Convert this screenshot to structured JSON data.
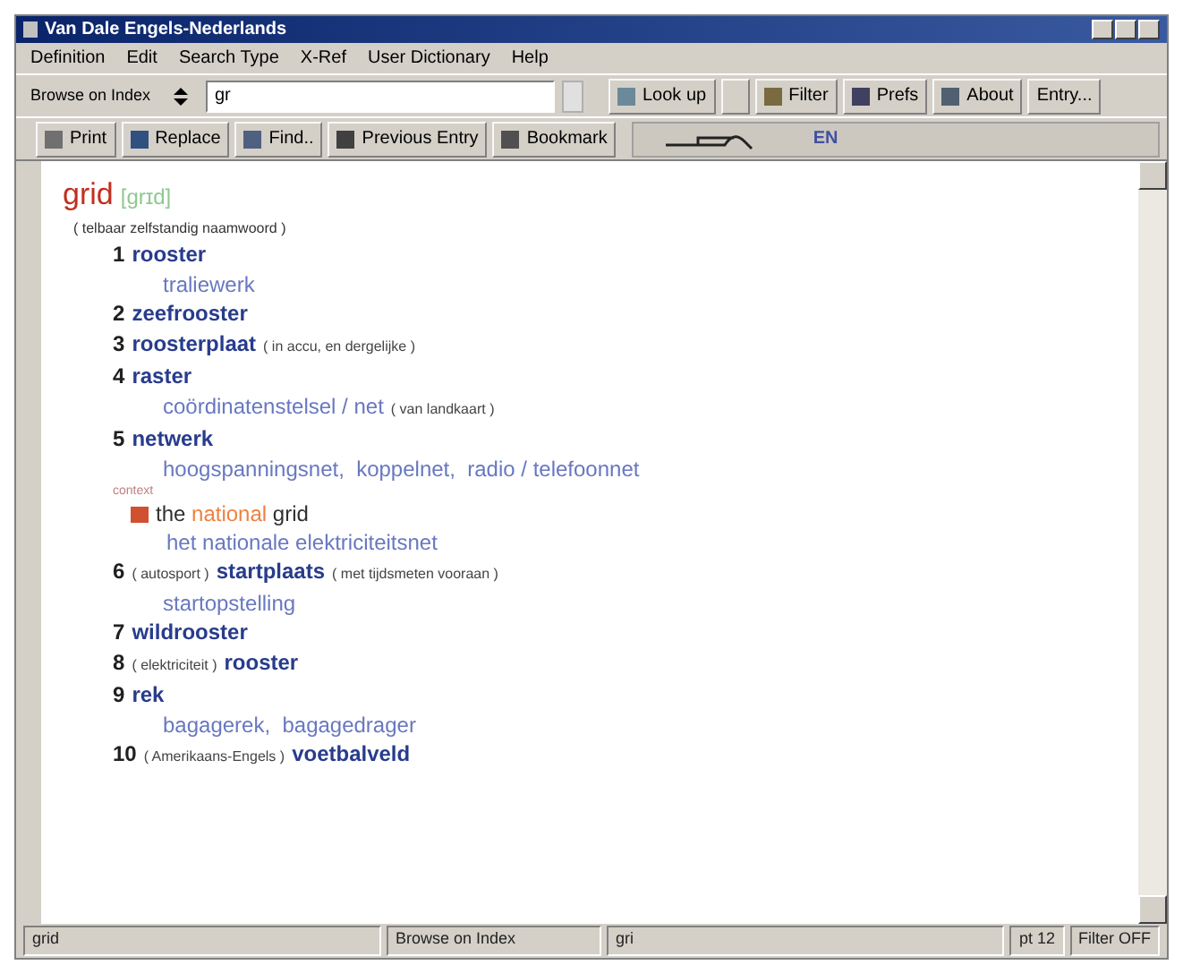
{
  "window": {
    "title": "Van Dale Engels-Nederlands"
  },
  "menu": [
    "Definition",
    "Edit",
    "Search Type",
    "X-Ref",
    "User Dictionary",
    "Help"
  ],
  "toolbar": {
    "mode": "Browse on Index",
    "search": {
      "value": "gr"
    },
    "buttons": [
      {
        "label": "Look up",
        "kind": "lookup"
      },
      {
        "kind": "blank"
      },
      {
        "label": "Filter",
        "kind": "filter"
      },
      {
        "label": "Prefs",
        "kind": "prefs"
      },
      {
        "label": "About",
        "kind": "about"
      },
      {
        "label": "Entry...",
        "kind": "plain"
      }
    ]
  },
  "toolbar2": {
    "buttons": [
      {
        "label": "Print",
        "kind": "print"
      },
      {
        "label": "Replace",
        "kind": "replace"
      },
      {
        "label": "Find..",
        "kind": "find"
      },
      {
        "label": "Previous Entry",
        "kind": "previous"
      },
      {
        "label": "Bookmark",
        "kind": "bookmark"
      }
    ],
    "language": "EN"
  },
  "entry": {
    "headword": "grid",
    "pronunciation": "[grɪd]",
    "grammar": "( telbaar zelfstandig naamwoord )",
    "senses": [
      {
        "number": "1",
        "word": "rooster",
        "translations": [
          "traliewerk"
        ]
      },
      {
        "number": "2",
        "word": "zeefrooster"
      },
      {
        "number": "3",
        "word": "roosterplaat",
        "note": "( in accu, en dergelijke )"
      },
      {
        "number": "4",
        "word": "raster",
        "translations": [
          "coördinatenstelsel / net"
        ],
        "translation_note": "( van landkaart )"
      },
      {
        "number": "5",
        "word": "netwerk",
        "translations": [
          "hoogspanningsnet,  koppelnet,  radio / telefoonnet"
        ],
        "context": "context",
        "examples": [
          {
            "before": "the",
            "keyword": "national",
            "after": "grid",
            "translation": "het nationale elektriciteitsnet"
          }
        ]
      },
      {
        "number": "6",
        "label": "( autosport )",
        "word": "startplaats",
        "note": "( met tijdsmeten vooraan )",
        "translations": [
          "startopstelling"
        ]
      },
      {
        "number": "7",
        "word": "wildrooster"
      },
      {
        "number": "8",
        "label": "( elektriciteit )",
        "word": "rooster"
      },
      {
        "number": "9",
        "word": "rek",
        "translations": [
          "bagagerek,  bagagedrager"
        ]
      },
      {
        "number": "10",
        "label": "( Amerikaans-Engels )",
        "word": "voetbalveld"
      }
    ]
  },
  "status_bar": [
    "grid",
    "Browse on Index",
    "gri",
    "pt 12",
    "Filter OFF"
  ]
}
